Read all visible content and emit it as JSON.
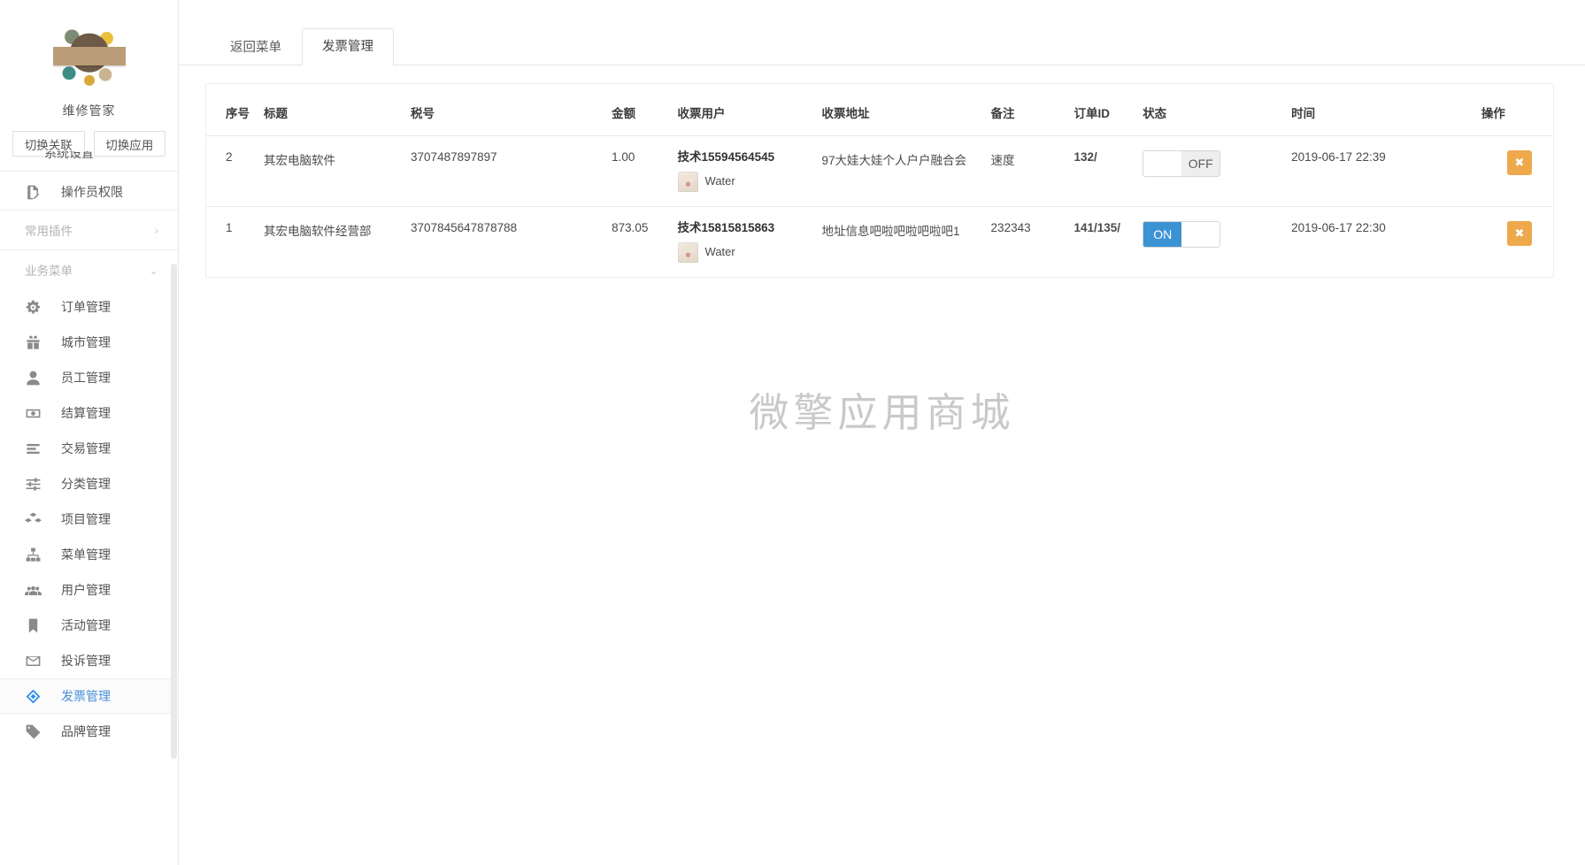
{
  "sidebar": {
    "logo_icon": "tools-repair-logo",
    "app_name": "维修管家",
    "switch_relation_label": "切换关联",
    "switch_app_label": "切换应用",
    "cut_item_label": "系统设置",
    "top_items": [
      {
        "label": "操作员权限",
        "icon": "document-pen-icon"
      }
    ],
    "groups": [
      {
        "label": "常用插件",
        "chevron": "›",
        "collapsed": true
      },
      {
        "label": "业务菜单",
        "chevron": "⌄",
        "collapsed": false
      }
    ],
    "items": [
      {
        "label": "订单管理",
        "icon": "gear-icon",
        "active": false
      },
      {
        "label": "城市管理",
        "icon": "gift-icon",
        "active": false
      },
      {
        "label": "员工管理",
        "icon": "user-icon",
        "active": false
      },
      {
        "label": "结算管理",
        "icon": "banknote-icon",
        "active": false
      },
      {
        "label": "交易管理",
        "icon": "list-lines-icon",
        "active": false
      },
      {
        "label": "分类管理",
        "icon": "sliders-icon",
        "active": false
      },
      {
        "label": "项目管理",
        "icon": "boxes-icon",
        "active": false
      },
      {
        "label": "菜单管理",
        "icon": "sitemap-icon",
        "active": false
      },
      {
        "label": "用户管理",
        "icon": "users-group-icon",
        "active": false
      },
      {
        "label": "活动管理",
        "icon": "bookmark-icon",
        "active": false
      },
      {
        "label": "投诉管理",
        "icon": "envelope-icon",
        "active": false
      },
      {
        "label": "发票管理",
        "icon": "ticket-icon",
        "active": true
      },
      {
        "label": "品牌管理",
        "icon": "tag-icon",
        "active": false
      }
    ]
  },
  "main": {
    "tabs": [
      {
        "label": "返回菜单",
        "active": false
      },
      {
        "label": "发票管理",
        "active": true
      }
    ],
    "watermark": "微擎应用商城",
    "table": {
      "headers": [
        "序号",
        "标题",
        "税号",
        "金额",
        "收票用户",
        "收票地址",
        "备注",
        "订单ID",
        "状态",
        "时间",
        "操作"
      ],
      "rows": [
        {
          "seq": "2",
          "title": "其宏电脑软件",
          "tax_no": "3707487897897",
          "amount": "1.00",
          "user_name": "技术15594564545",
          "user_sub_name": "Water",
          "user_avatar_icon": "user-avatar-thumb",
          "address": "97大娃大娃个人户户融合会",
          "note": "速度",
          "order_id": "132/",
          "status": "OFF",
          "status_on": false,
          "time": "2019-06-17 22:39",
          "delete_label": "✖"
        },
        {
          "seq": "1",
          "title": "其宏电脑软件经营部",
          "tax_no": "3707845647878788",
          "amount": "873.05",
          "user_name": "技术15815815863",
          "user_sub_name": "Water",
          "user_avatar_icon": "user-avatar-thumb",
          "address": "地址信息吧啦吧啦吧啦吧1",
          "note": "232343",
          "order_id": "141/135/",
          "status": "ON",
          "status_on": true,
          "time": "2019-06-17 22:30",
          "delete_label": "✖"
        }
      ]
    }
  },
  "colors": {
    "accent_blue": "#2d8cf0",
    "toggle_on": "#3c93d4",
    "delete_orange": "#eda94c",
    "watermark_gray": "#c9c9c9"
  }
}
